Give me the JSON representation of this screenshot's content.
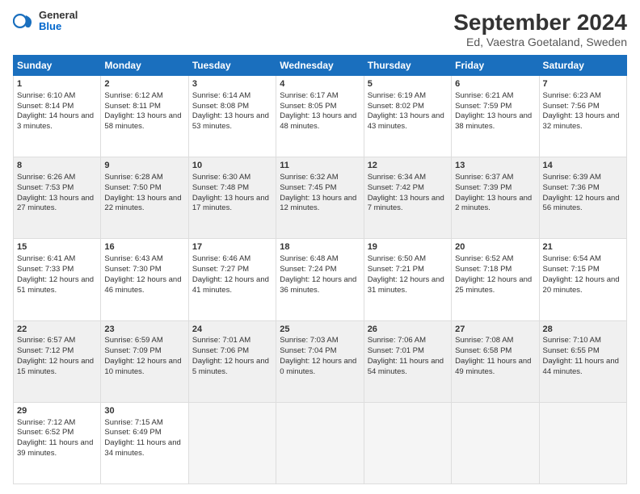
{
  "logo": {
    "line1": "General",
    "line2": "Blue"
  },
  "title": "September 2024",
  "subtitle": "Ed, Vaestra Goetaland, Sweden",
  "days": [
    "Sunday",
    "Monday",
    "Tuesday",
    "Wednesday",
    "Thursday",
    "Friday",
    "Saturday"
  ],
  "weeks": [
    [
      {
        "num": "1",
        "sunrise": "Sunrise: 6:10 AM",
        "sunset": "Sunset: 8:14 PM",
        "daylight": "Daylight: 14 hours and 3 minutes."
      },
      {
        "num": "2",
        "sunrise": "Sunrise: 6:12 AM",
        "sunset": "Sunset: 8:11 PM",
        "daylight": "Daylight: 13 hours and 58 minutes."
      },
      {
        "num": "3",
        "sunrise": "Sunrise: 6:14 AM",
        "sunset": "Sunset: 8:08 PM",
        "daylight": "Daylight: 13 hours and 53 minutes."
      },
      {
        "num": "4",
        "sunrise": "Sunrise: 6:17 AM",
        "sunset": "Sunset: 8:05 PM",
        "daylight": "Daylight: 13 hours and 48 minutes."
      },
      {
        "num": "5",
        "sunrise": "Sunrise: 6:19 AM",
        "sunset": "Sunset: 8:02 PM",
        "daylight": "Daylight: 13 hours and 43 minutes."
      },
      {
        "num": "6",
        "sunrise": "Sunrise: 6:21 AM",
        "sunset": "Sunset: 7:59 PM",
        "daylight": "Daylight: 13 hours and 38 minutes."
      },
      {
        "num": "7",
        "sunrise": "Sunrise: 6:23 AM",
        "sunset": "Sunset: 7:56 PM",
        "daylight": "Daylight: 13 hours and 32 minutes."
      }
    ],
    [
      {
        "num": "8",
        "sunrise": "Sunrise: 6:26 AM",
        "sunset": "Sunset: 7:53 PM",
        "daylight": "Daylight: 13 hours and 27 minutes."
      },
      {
        "num": "9",
        "sunrise": "Sunrise: 6:28 AM",
        "sunset": "Sunset: 7:50 PM",
        "daylight": "Daylight: 13 hours and 22 minutes."
      },
      {
        "num": "10",
        "sunrise": "Sunrise: 6:30 AM",
        "sunset": "Sunset: 7:48 PM",
        "daylight": "Daylight: 13 hours and 17 minutes."
      },
      {
        "num": "11",
        "sunrise": "Sunrise: 6:32 AM",
        "sunset": "Sunset: 7:45 PM",
        "daylight": "Daylight: 13 hours and 12 minutes."
      },
      {
        "num": "12",
        "sunrise": "Sunrise: 6:34 AM",
        "sunset": "Sunset: 7:42 PM",
        "daylight": "Daylight: 13 hours and 7 minutes."
      },
      {
        "num": "13",
        "sunrise": "Sunrise: 6:37 AM",
        "sunset": "Sunset: 7:39 PM",
        "daylight": "Daylight: 13 hours and 2 minutes."
      },
      {
        "num": "14",
        "sunrise": "Sunrise: 6:39 AM",
        "sunset": "Sunset: 7:36 PM",
        "daylight": "Daylight: 12 hours and 56 minutes."
      }
    ],
    [
      {
        "num": "15",
        "sunrise": "Sunrise: 6:41 AM",
        "sunset": "Sunset: 7:33 PM",
        "daylight": "Daylight: 12 hours and 51 minutes."
      },
      {
        "num": "16",
        "sunrise": "Sunrise: 6:43 AM",
        "sunset": "Sunset: 7:30 PM",
        "daylight": "Daylight: 12 hours and 46 minutes."
      },
      {
        "num": "17",
        "sunrise": "Sunrise: 6:46 AM",
        "sunset": "Sunset: 7:27 PM",
        "daylight": "Daylight: 12 hours and 41 minutes."
      },
      {
        "num": "18",
        "sunrise": "Sunrise: 6:48 AM",
        "sunset": "Sunset: 7:24 PM",
        "daylight": "Daylight: 12 hours and 36 minutes."
      },
      {
        "num": "19",
        "sunrise": "Sunrise: 6:50 AM",
        "sunset": "Sunset: 7:21 PM",
        "daylight": "Daylight: 12 hours and 31 minutes."
      },
      {
        "num": "20",
        "sunrise": "Sunrise: 6:52 AM",
        "sunset": "Sunset: 7:18 PM",
        "daylight": "Daylight: 12 hours and 25 minutes."
      },
      {
        "num": "21",
        "sunrise": "Sunrise: 6:54 AM",
        "sunset": "Sunset: 7:15 PM",
        "daylight": "Daylight: 12 hours and 20 minutes."
      }
    ],
    [
      {
        "num": "22",
        "sunrise": "Sunrise: 6:57 AM",
        "sunset": "Sunset: 7:12 PM",
        "daylight": "Daylight: 12 hours and 15 minutes."
      },
      {
        "num": "23",
        "sunrise": "Sunrise: 6:59 AM",
        "sunset": "Sunset: 7:09 PM",
        "daylight": "Daylight: 12 hours and 10 minutes."
      },
      {
        "num": "24",
        "sunrise": "Sunrise: 7:01 AM",
        "sunset": "Sunset: 7:06 PM",
        "daylight": "Daylight: 12 hours and 5 minutes."
      },
      {
        "num": "25",
        "sunrise": "Sunrise: 7:03 AM",
        "sunset": "Sunset: 7:04 PM",
        "daylight": "Daylight: 12 hours and 0 minutes."
      },
      {
        "num": "26",
        "sunrise": "Sunrise: 7:06 AM",
        "sunset": "Sunset: 7:01 PM",
        "daylight": "Daylight: 11 hours and 54 minutes."
      },
      {
        "num": "27",
        "sunrise": "Sunrise: 7:08 AM",
        "sunset": "Sunset: 6:58 PM",
        "daylight": "Daylight: 11 hours and 49 minutes."
      },
      {
        "num": "28",
        "sunrise": "Sunrise: 7:10 AM",
        "sunset": "Sunset: 6:55 PM",
        "daylight": "Daylight: 11 hours and 44 minutes."
      }
    ],
    [
      {
        "num": "29",
        "sunrise": "Sunrise: 7:12 AM",
        "sunset": "Sunset: 6:52 PM",
        "daylight": "Daylight: 11 hours and 39 minutes."
      },
      {
        "num": "30",
        "sunrise": "Sunrise: 7:15 AM",
        "sunset": "Sunset: 6:49 PM",
        "daylight": "Daylight: 11 hours and 34 minutes."
      },
      null,
      null,
      null,
      null,
      null
    ]
  ]
}
